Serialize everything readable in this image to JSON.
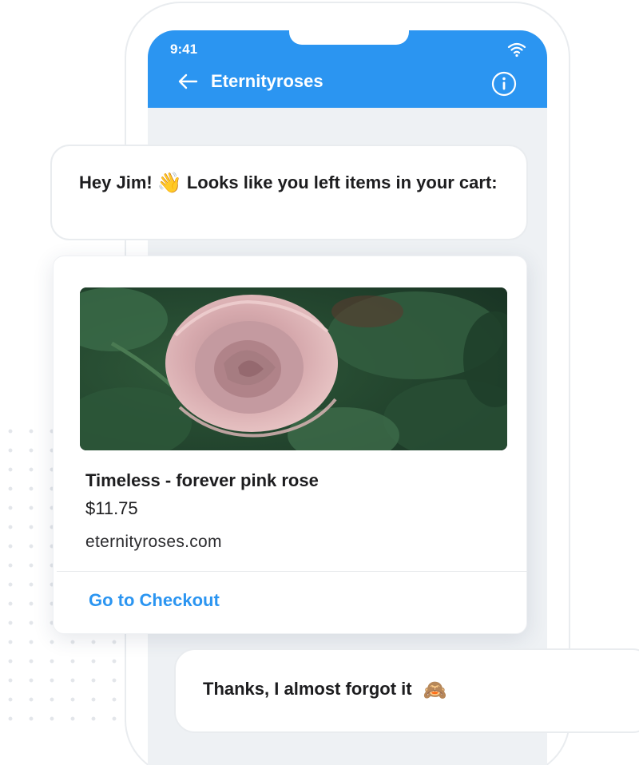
{
  "status_bar": {
    "time": "9:41",
    "wifi_icon": "wifi-icon"
  },
  "header": {
    "title": "Eternityroses",
    "back_icon": "arrow-left-icon",
    "info_icon": "info-icon",
    "background_color": "#2b95f1"
  },
  "messages": {
    "bot": {
      "greeting": "Hey Jim!",
      "emoji": "👋",
      "text": "Looks like you left items in your cart:"
    },
    "user": {
      "text": "Thanks, I almost forgot it",
      "emoji": "🙈"
    }
  },
  "product_card": {
    "image": "pink-rose-photo",
    "name": "Timeless - forever pink rose",
    "price": "$11.75",
    "domain": "eternityroses.com",
    "cta_label": "Go to Checkout",
    "cta_color": "#2b95f1"
  }
}
